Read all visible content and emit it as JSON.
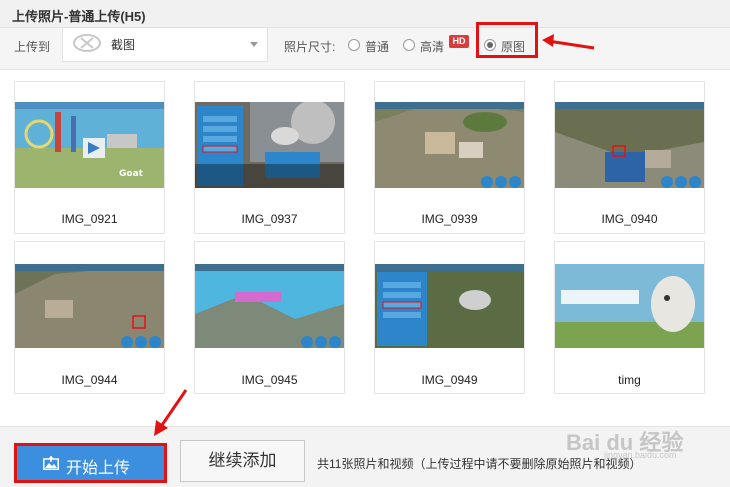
{
  "window": {
    "title": "上传照片-普通上传(H5)"
  },
  "toolbar": {
    "upload_to_label": "上传到",
    "album_name": "截图",
    "size_label": "照片尺寸:",
    "size_options": [
      {
        "label": "普通",
        "checked": false
      },
      {
        "label": "高清",
        "checked": false,
        "badge": "HD"
      },
      {
        "label": "原图",
        "checked": true
      }
    ]
  },
  "photos": [
    {
      "name": "IMG_0921"
    },
    {
      "name": "IMG_0937"
    },
    {
      "name": "IMG_0939"
    },
    {
      "name": "IMG_0940"
    },
    {
      "name": "IMG_0944"
    },
    {
      "name": "IMG_0945"
    },
    {
      "name": "IMG_0949"
    },
    {
      "name": "timg"
    }
  ],
  "footer": {
    "start_label": "开始上传",
    "continue_label": "继续添加",
    "hint": "共11张照片和视频（上传过程中请不要删除原始照片和视频）"
  },
  "watermark": {
    "logo": "Bai du 经验",
    "sub": "jingyan.baidu.com"
  },
  "colors": {
    "accent": "#3c8fdf",
    "highlight": "#e31212",
    "hd_badge": "#d83c3c"
  }
}
